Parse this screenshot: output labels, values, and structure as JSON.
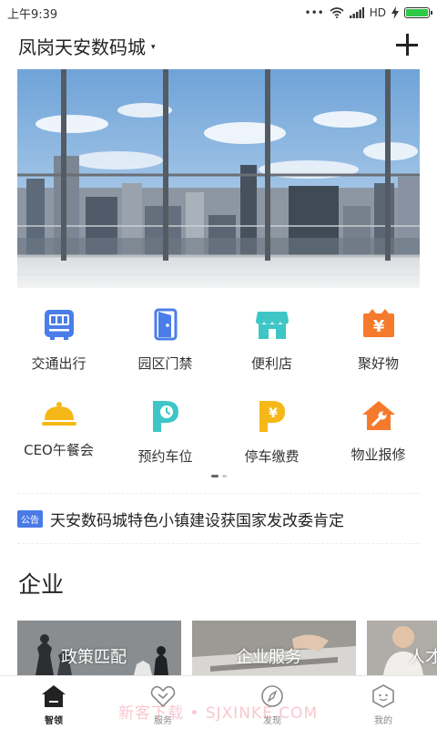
{
  "status_bar": {
    "time": "上午9:39",
    "signal_dots": "•••",
    "network": "HD",
    "battery_level": 1.0
  },
  "header": {
    "location": "凤岗天安数码城",
    "caret": "▾"
  },
  "services": [
    {
      "label": "交通出行",
      "icon": "bus-icon",
      "color": "#4a7de8"
    },
    {
      "label": "园区门禁",
      "icon": "door-icon",
      "color": "#4a7de8"
    },
    {
      "label": "便利店",
      "icon": "store-icon",
      "color": "#3ec6c6"
    },
    {
      "label": "聚好物",
      "icon": "yen-box-icon",
      "color": "#f57a2c"
    },
    {
      "label": "CEO午餐会",
      "icon": "cloche-icon",
      "color": "#f5b818"
    },
    {
      "label": "预约车位",
      "icon": "parking-clock-icon",
      "color": "#3ec6c6"
    },
    {
      "label": "停车缴费",
      "icon": "parking-yen-icon",
      "color": "#f5b818"
    },
    {
      "label": "物业报修",
      "icon": "house-wrench-icon",
      "color": "#f57a2c"
    }
  ],
  "notice": {
    "tag": "公告",
    "text": "天安数码城特色小镇建设获国家发改委肯定"
  },
  "section": {
    "title": "企业"
  },
  "cards": [
    {
      "label": "政策匹配"
    },
    {
      "label": "企业服务"
    },
    {
      "label": "人才"
    }
  ],
  "tabbar": {
    "items": [
      {
        "label": "智领",
        "icon": "home-icon",
        "active": true
      },
      {
        "label": "服务",
        "icon": "heart-icon",
        "active": false
      },
      {
        "label": "发现",
        "icon": "compass-icon",
        "active": false
      },
      {
        "label": "我的",
        "icon": "profile-icon",
        "active": false
      }
    ]
  },
  "watermark": "新客下载 • SJXINKE.COM"
}
